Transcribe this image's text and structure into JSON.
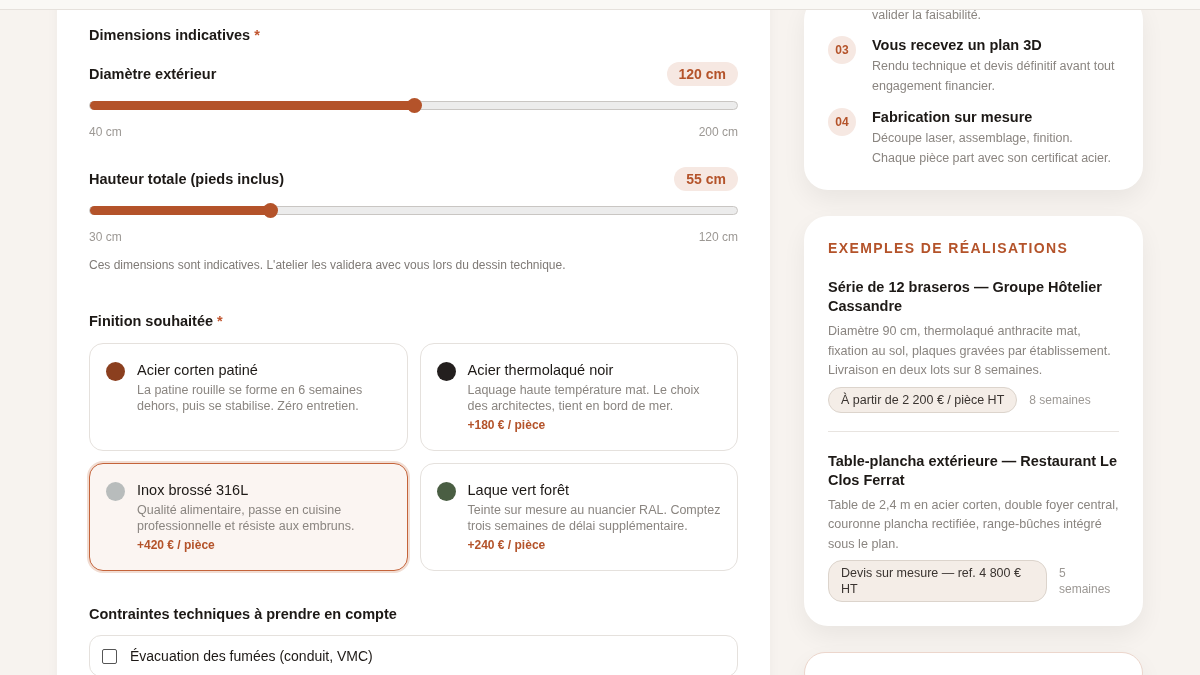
{
  "dimensions": {
    "label": "Dimensions indicatives",
    "required_mark": "*",
    "sliders": [
      {
        "label": "Diamètre extérieur",
        "value": "120 cm",
        "level": 0.5,
        "min": "40 cm",
        "max": "200 cm"
      },
      {
        "label": "Hauteur totale (pieds inclus)",
        "value": "55 cm",
        "level": 0.278,
        "min": "30 cm",
        "max": "120 cm"
      }
    ],
    "note": "Ces dimensions sont indicatives. L'atelier les validera avec vous lors du dessin technique."
  },
  "finish": {
    "label": "Finition souhaitée",
    "required_mark": "*",
    "options": [
      {
        "name": "Acier corten patiné",
        "description": "La patine rouille se forme en 6 semaines dehors, puis se stabilise. Zéro entretien.",
        "color": "#8b3f1f",
        "selected": false
      },
      {
        "name": "Acier thermolaqué noir",
        "description": "Laquage haute température mat. Le choix des architectes, tient en bord de mer.",
        "price": "+180 € / pièce",
        "color": "#231f1e",
        "selected": false
      },
      {
        "name": "Inox brossé 316L",
        "description": "Qualité alimentaire, passe en cuisine professionnelle et résiste aux embruns.",
        "price": "+420 € / pièce",
        "color": "#b8bcbc",
        "selected": true
      },
      {
        "name": "Laque vert forêt",
        "description": "Teinte sur mesure au nuancier RAL. Comptez trois semaines de délai supplémentaire.",
        "price": "+240 € / pièce",
        "color": "#4a5e43",
        "selected": false
      }
    ]
  },
  "constraints": {
    "label": "Contraintes techniques à prendre en compte",
    "items": [
      {
        "label": "Évacuation des fumées (conduit, VMC)",
        "checked": false
      }
    ]
  },
  "steps": {
    "partial_text": "valider la faisabilité.",
    "items": [
      {
        "number": "03",
        "title": "Vous recevez un plan 3D",
        "description": "Rendu technique et devis définitif avant tout engagement financier."
      },
      {
        "number": "04",
        "title": "Fabrication sur mesure",
        "description": "Découpe laser, assemblage, finition. Chaque pièce part avec son certificat acier."
      }
    ]
  },
  "examples": {
    "title": "EXEMPLES DE RÉALISATIONS",
    "items": [
      {
        "title": "Série de 12 braseros — Groupe Hôtelier Cassandre",
        "description": "Diamètre 90 cm, thermolaqué anthracite mat, fixation au sol, plaques gravées par établissement. Livraison en deux lots sur 8 semaines.",
        "price": "À partir de 2 200 € / pièce HT",
        "duration": "8 semaines"
      },
      {
        "title": "Table-plancha extérieure — Restaurant Le Clos Ferrat",
        "description": "Table de 2,4 m en acier corten, double foyer central, couronne plancha rectifiée, range-bûches intégré sous le plan.",
        "price": "Devis sur mesure — ref. 4 800 € HT",
        "duration": "5 semaines"
      }
    ]
  }
}
